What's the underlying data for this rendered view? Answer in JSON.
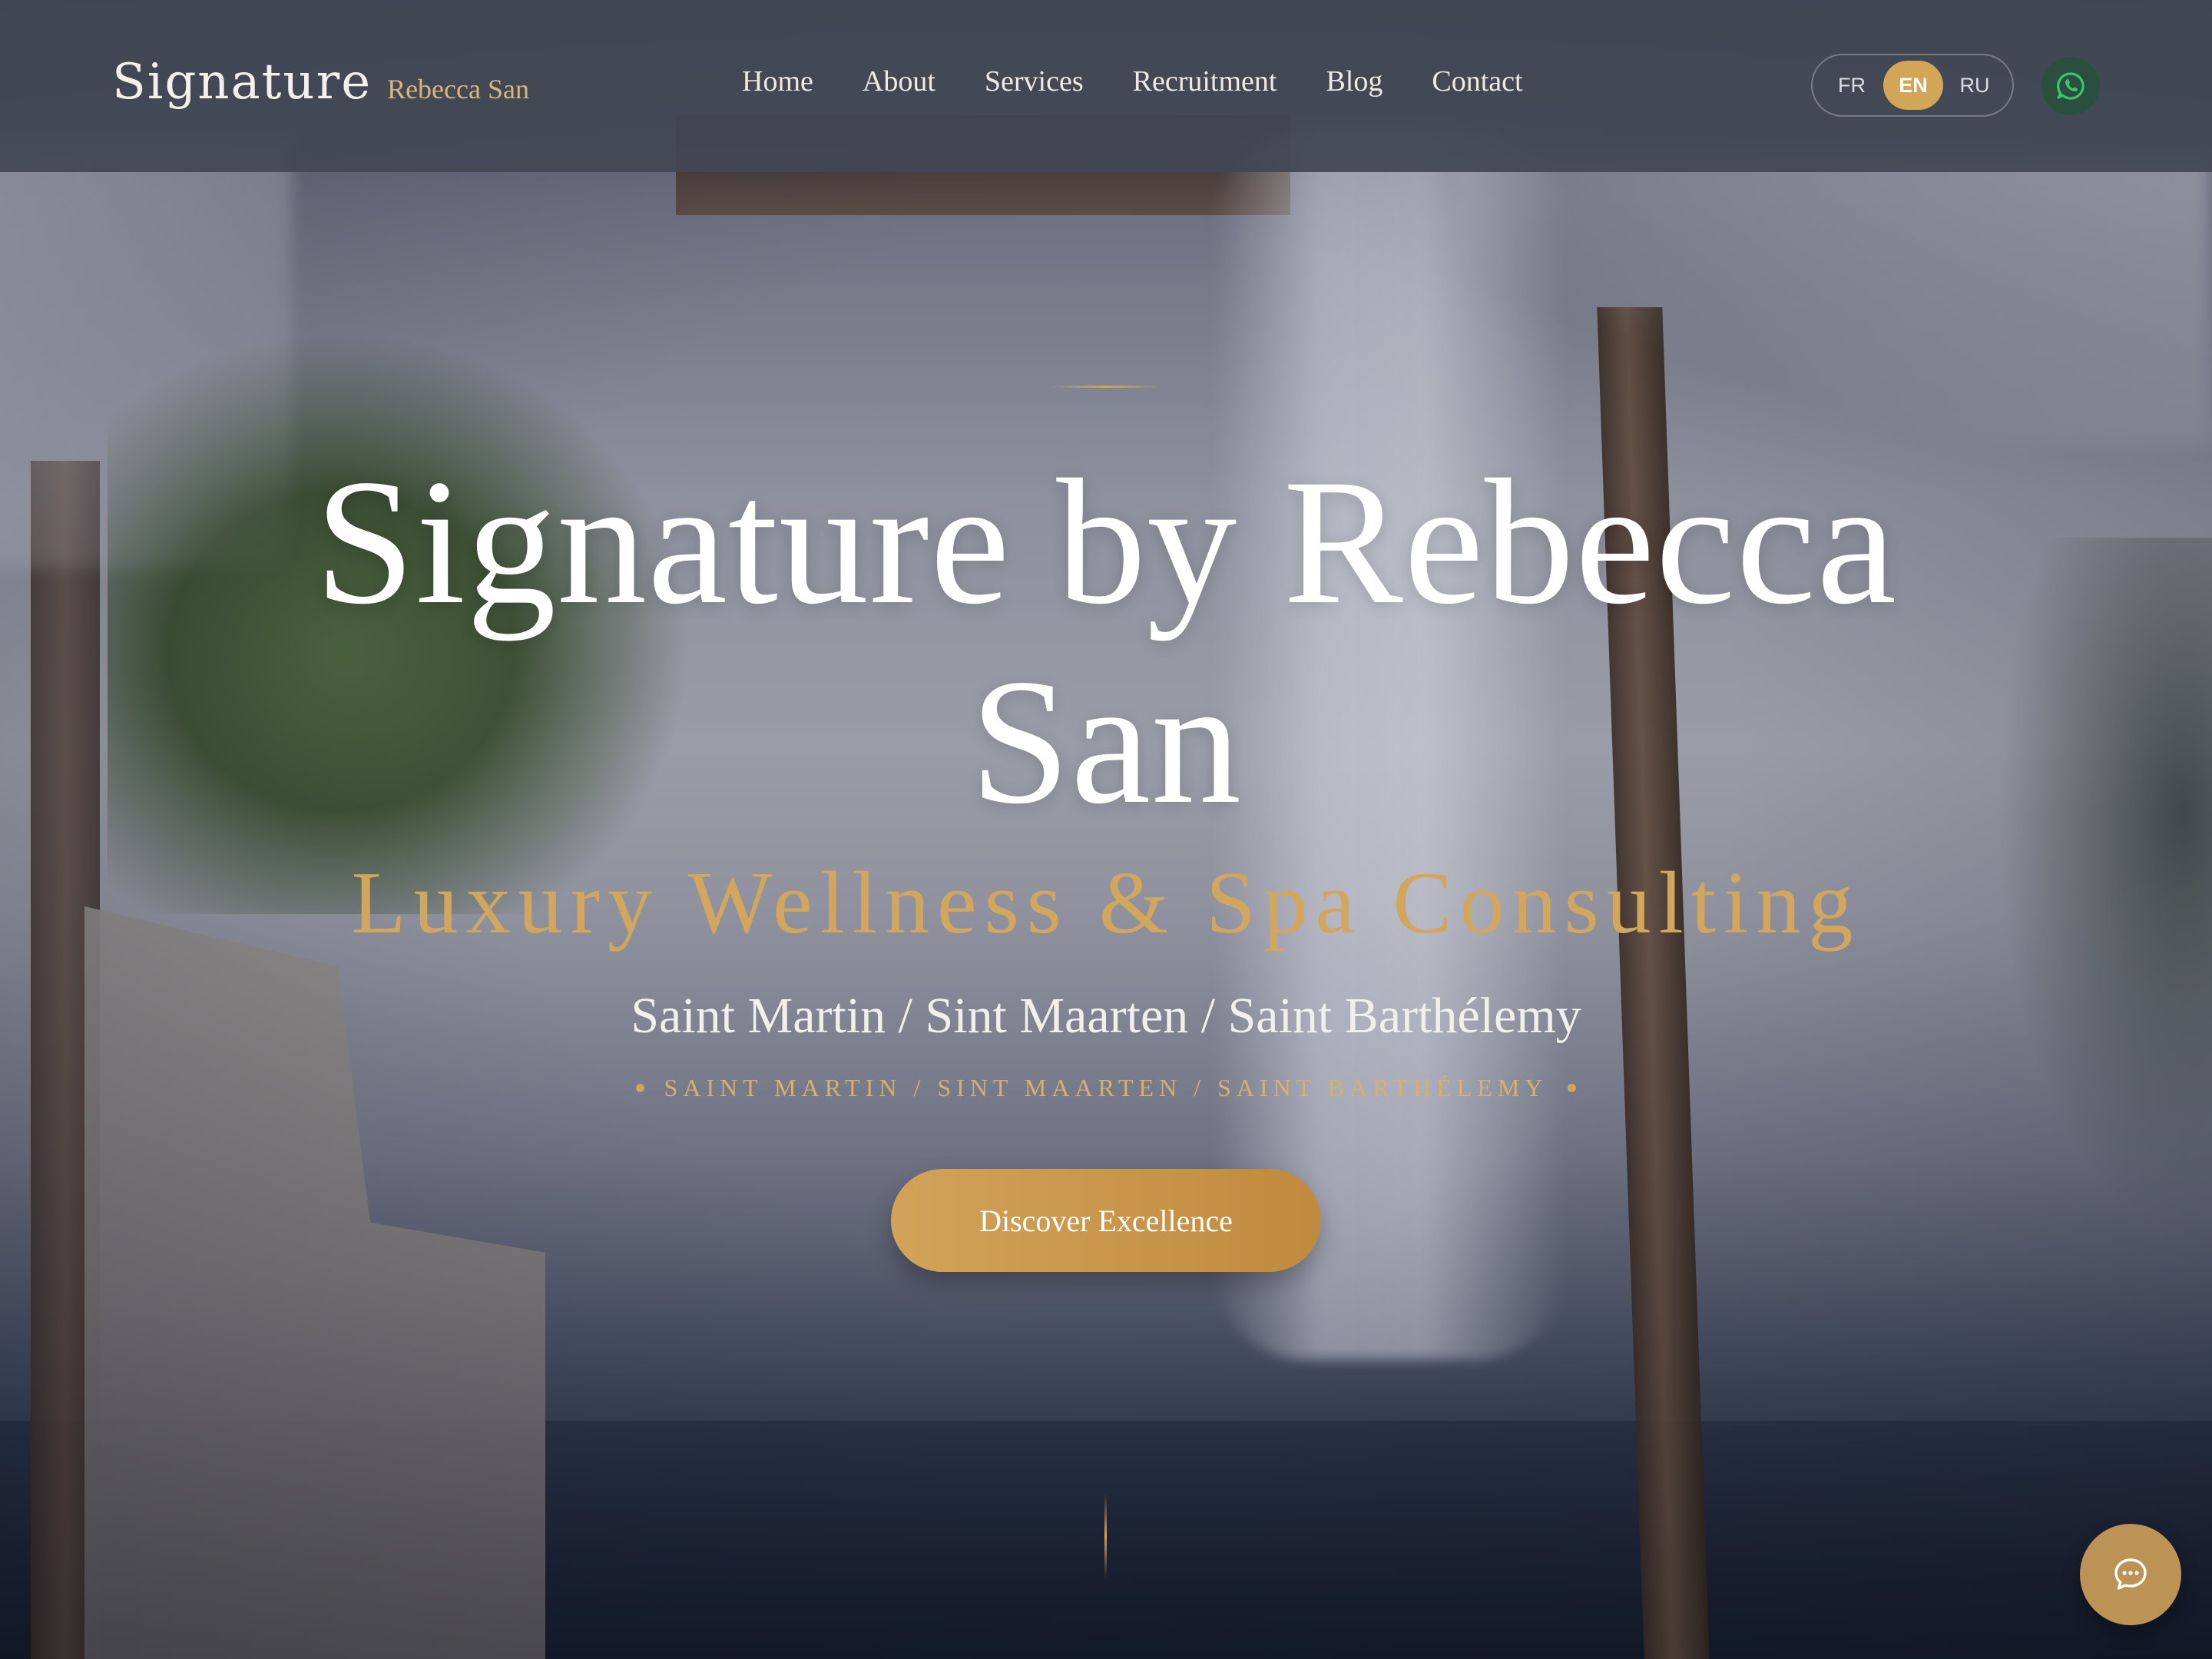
{
  "header": {
    "brand": "Signature",
    "brand_sub": "Rebecca San",
    "nav": [
      "Home",
      "About",
      "Services",
      "Recruitment",
      "Blog",
      "Contact"
    ],
    "languages": [
      "FR",
      "EN",
      "RU"
    ],
    "active_language": "EN",
    "whatsapp_icon": "whatsapp-icon"
  },
  "hero": {
    "title": "Signature by Rebecca San",
    "subtitle": "Luxury Wellness & Spa Consulting",
    "locations": "Saint Martin / Sint Maarten / Saint Barthélemy",
    "tagline": "SAINT MARTIN / SINT MAARTEN / SAINT BARTHÉLEMY",
    "cta": "Discover Excellence"
  },
  "chat": {
    "icon": "chat-bubble-icon"
  },
  "colors": {
    "gold": "#d3a65e",
    "header_bg": "#424754",
    "whatsapp_bg": "#2b4f3f",
    "whatsapp_icon": "#3ec46d"
  }
}
